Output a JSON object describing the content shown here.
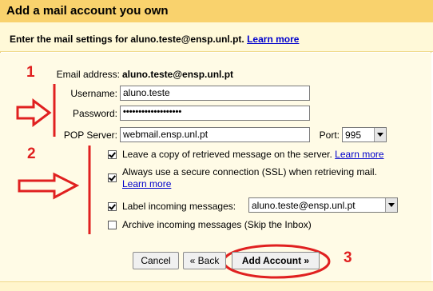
{
  "dialog": {
    "title": "Add a mail account you own",
    "subtitle": "Enter the mail settings for aluno.teste@ensp.unl.pt.",
    "learn_more": "Learn more"
  },
  "form": {
    "email_label": "Email address:",
    "email_value": "aluno.teste@ensp.unl.pt",
    "username_label": "Username:",
    "username_value": "aluno.teste",
    "password_label": "Password:",
    "password_value": "•••••••••••••••••••",
    "pop_label": "POP Server:",
    "pop_value": "webmail.ensp.unl.pt",
    "port_label": "Port:",
    "port_value": "995"
  },
  "options": {
    "leave_copy": "Leave a copy of retrieved message on the server.",
    "leave_copy_link": "Learn more",
    "ssl": "Always use a secure connection (SSL) when retrieving mail.",
    "ssl_link": "Learn more",
    "label_incoming": "Label incoming messages:",
    "label_value": "aluno.teste@ensp.unl.pt",
    "archive": "Archive incoming messages (Skip the Inbox)"
  },
  "buttons": {
    "cancel": "Cancel",
    "back": "« Back",
    "add": "Add Account »"
  },
  "annotations": {
    "n1": "1",
    "n2": "2",
    "n3": "3",
    "color": "#e02020"
  }
}
